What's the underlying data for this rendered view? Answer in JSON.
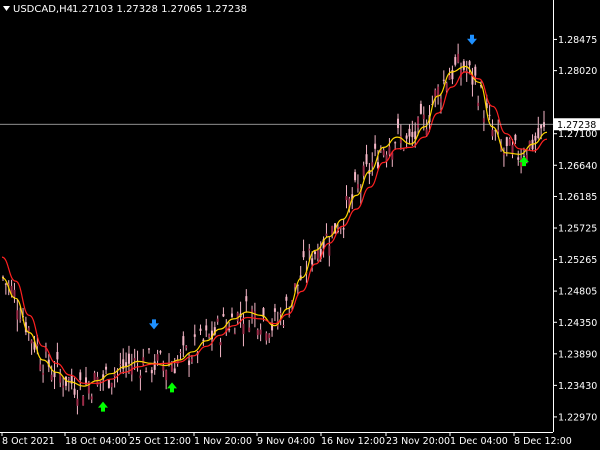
{
  "header": {
    "symbol": "USDCAD,H4",
    "ohlc": "1.27103 1.27328 1.27065 1.27238",
    "menu_icon": "triangle-down-icon"
  },
  "price_axis": {
    "ticks": [
      "1.28475",
      "1.28020",
      "1.27100",
      "1.26640",
      "1.26185",
      "1.25725",
      "1.25265",
      "1.24805",
      "1.24350",
      "1.23890",
      "1.23430",
      "1.22970"
    ],
    "current_price": "1.27238"
  },
  "time_axis": {
    "ticks": [
      "8 Oct 2021",
      "18 Oct 04:00",
      "25 Oct 12:00",
      "1 Nov 20:00",
      "9 Nov 04:00",
      "16 Nov 12:00",
      "23 Nov 20:00",
      "1 Dec 04:00",
      "8 Dec 12:00"
    ]
  },
  "colors": {
    "background": "#000000",
    "grid_border": "#ffffff",
    "candles": "#f4b6c6",
    "candle_dark": "#9c2b48",
    "fast_ma": "#ffd700",
    "slow_ma": "#ff2020",
    "up_arrow": "#00ff00",
    "down_arrow": "#1e90ff",
    "price_line": "#c0c0c0"
  },
  "chart_data": {
    "type": "line",
    "title": "USDCAD,H4",
    "ylim": [
      1.2275,
      1.2905
    ],
    "x_ticks": [
      "8 Oct 2021",
      "18 Oct 04:00",
      "25 Oct 12:00",
      "1 Nov 20:00",
      "9 Nov 04:00",
      "16 Nov 12:00",
      "23 Nov 20:00",
      "1 Dec 04:00",
      "8 Dec 12:00"
    ],
    "series": [
      {
        "values": [
          1.25,
          1.247,
          1.242,
          1.238,
          1.2362,
          1.2348,
          1.2342,
          1.235,
          1.236,
          1.237,
          1.2378,
          1.2375,
          1.2372,
          1.238,
          1.2392,
          1.2408,
          1.2425,
          1.244,
          1.245,
          1.2445,
          1.243,
          1.2455,
          1.25,
          1.254,
          1.256,
          1.2585,
          1.262,
          1.2655,
          1.269,
          1.2705,
          1.2695,
          1.272,
          1.2765,
          1.28,
          1.2808,
          1.2785,
          1.272,
          1.2682,
          1.268,
          1.2695,
          1.2712
        ]
      },
      {
        "values": [
          1.253,
          1.2495,
          1.2445,
          1.24,
          1.2375,
          1.2358,
          1.2346,
          1.2346,
          1.2352,
          1.2362,
          1.237,
          1.2374,
          1.2375,
          1.2377,
          1.2386,
          1.24,
          1.2416,
          1.243,
          1.2442,
          1.244,
          1.2433,
          1.2447,
          1.248,
          1.252,
          1.255,
          1.2575,
          1.26,
          1.2632,
          1.2668,
          1.2688,
          1.269,
          1.2705,
          1.274,
          1.2778,
          1.28,
          1.279,
          1.275,
          1.271,
          1.2688,
          1.2685,
          1.2702
        ]
      }
    ],
    "signals": [
      {
        "type": "up",
        "price": 1.2312
      },
      {
        "type": "down",
        "price": 1.2432
      },
      {
        "type": "up",
        "price": 1.234
      },
      {
        "type": "down",
        "price": 1.2847
      },
      {
        "type": "up",
        "price": 1.267
      }
    ]
  }
}
